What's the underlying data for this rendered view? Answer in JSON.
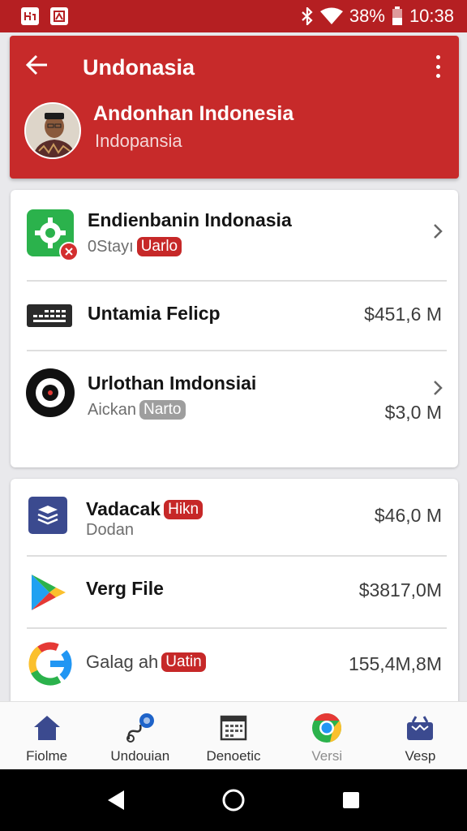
{
  "status_bar": {
    "battery": "38%",
    "time": "10:38",
    "icons": [
      "notification-icon",
      "image-icon",
      "bluetooth-icon",
      "wifi-icon",
      "battery-icon"
    ]
  },
  "header": {
    "title": "Undonasia",
    "profile_name": "Andonhan Indonesia",
    "profile_subtitle": "Indopansia"
  },
  "card1": {
    "items": [
      {
        "title": "Endienbanin Indonasia",
        "subtitle": "0Stayı",
        "tag": "Uarlo",
        "value": "",
        "icon": "settings-app-icon"
      },
      {
        "title": "Untamia Felicp",
        "subtitle": "",
        "tag": "",
        "value": "$451,6 M",
        "icon": "keyboard-icon"
      },
      {
        "title": "Urlothan Imdonsiai",
        "subtitle": "Aickan",
        "tag": "Narto",
        "value": "$3,0  M",
        "icon": "target-icon"
      }
    ]
  },
  "card2": {
    "items": [
      {
        "title": "Vadacak",
        "title_tag": "Hikn",
        "subtitle": "Dodan",
        "value": "$46,0  M",
        "icon": "stack-app-icon"
      },
      {
        "title": "Verg File",
        "value": "$3817,0M",
        "icon": "play-store-icon"
      },
      {
        "title": "Galag ah",
        "tag": "Uatin",
        "value": "155,4M,8M",
        "icon": "google-icon"
      }
    ]
  },
  "bottom_nav": [
    {
      "label": "Fiolme",
      "icon": "home-icon"
    },
    {
      "label": "Undouian",
      "icon": "satellite-icon"
    },
    {
      "label": "Denoetic",
      "icon": "calendar-icon"
    },
    {
      "label": "Versi",
      "icon": "chrome-icon"
    },
    {
      "label": "Vesp",
      "icon": "basket-icon"
    }
  ],
  "colors": {
    "brand": "#c72a2a",
    "status_bar": "#b51f22",
    "tag": "#c62828",
    "tag_gray": "#9e9e9e",
    "nav_icon": "#3b4a8f"
  }
}
